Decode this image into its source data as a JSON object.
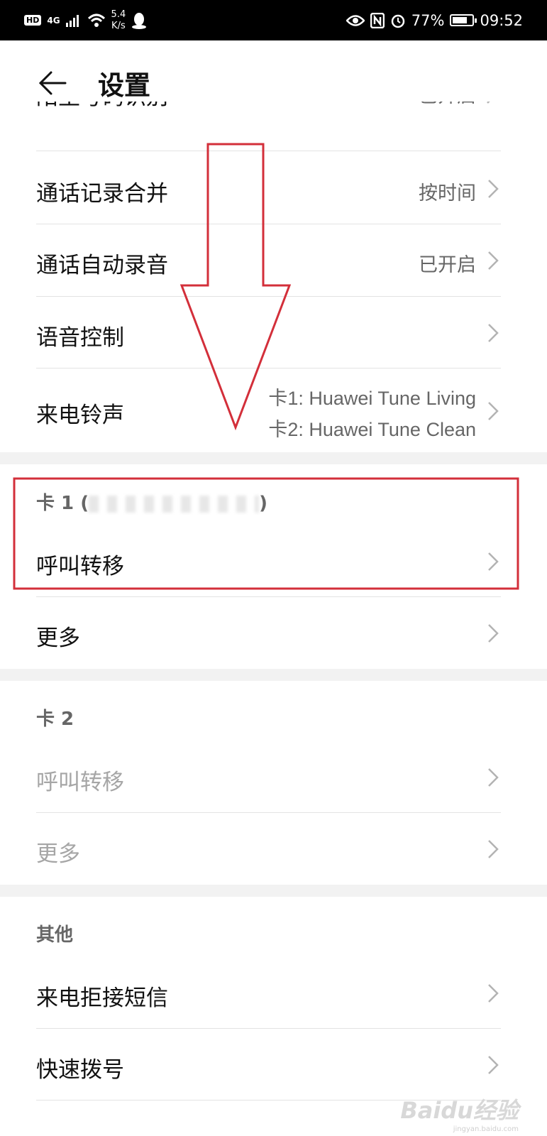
{
  "status_bar": {
    "hd": "HD",
    "network": "4G",
    "speed_value": "5.4",
    "speed_unit": "K/s",
    "battery": "77%",
    "battery_level": 0.77,
    "time": "09:52",
    "icons": [
      "signal-icon",
      "wifi-icon",
      "qq-icon",
      "eye-icon",
      "nfc-icon",
      "alarm-icon",
      "battery-icon"
    ]
  },
  "header": {
    "title": "设置"
  },
  "clipped_row": {
    "label": "陌生号码识别",
    "value": "已开启"
  },
  "general": [
    {
      "label": "通话记录合并",
      "value": "按时间"
    },
    {
      "label": "通话自动录音",
      "value": "已开启"
    },
    {
      "label": "语音控制",
      "value": ""
    },
    {
      "label": "来电铃声",
      "value_line1": "卡1: Huawei Tune Living",
      "value_line2": "卡2: Huawei Tune Clean"
    }
  ],
  "card1": {
    "title": "卡 1 (",
    "title_end": ")",
    "items": [
      {
        "label": "呼叫转移"
      },
      {
        "label": "更多"
      }
    ]
  },
  "card2": {
    "title": "卡 2",
    "items": [
      {
        "label": "呼叫转移"
      },
      {
        "label": "更多"
      }
    ]
  },
  "other": {
    "title": "其他",
    "items": [
      {
        "label": "来电拒接短信"
      },
      {
        "label": "快速拨号"
      }
    ]
  },
  "watermark": {
    "text": "Baidu经验",
    "sub": "jingyan.baidu.com"
  },
  "colors": {
    "annotation": "#d32f3a",
    "divider": "#e3e3e3",
    "section_bg": "#f2f2f2"
  }
}
